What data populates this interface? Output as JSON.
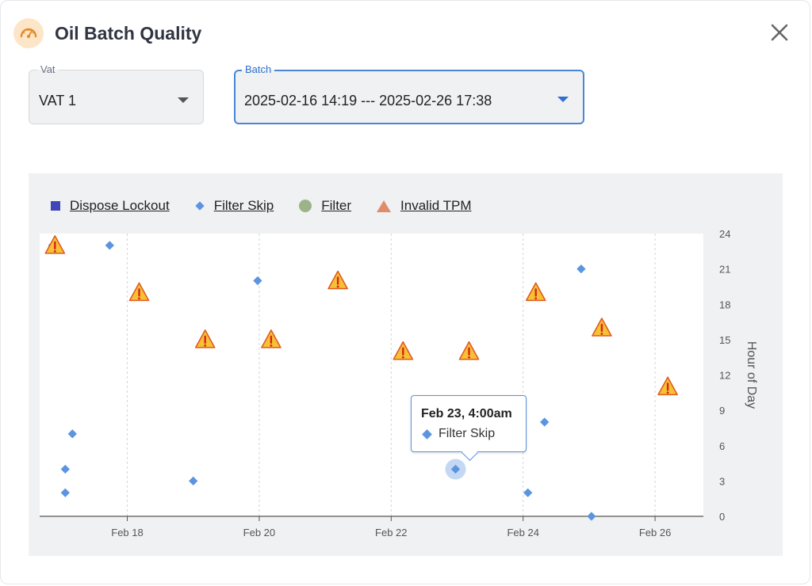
{
  "header": {
    "title": "Oil Batch Quality",
    "icon": "gauge-icon",
    "close_icon": "close-icon"
  },
  "filters": {
    "vat": {
      "label": "Vat",
      "value": "VAT 1"
    },
    "batch": {
      "label": "Batch",
      "value": "2025-02-16 14:19 --- 2025-02-26 17:38"
    }
  },
  "legend": [
    {
      "label": "Dispose Lockout",
      "marker": "square",
      "color": "#3f48b8"
    },
    {
      "label": "Filter Skip",
      "marker": "diamond",
      "color": "#5b94e0"
    },
    {
      "label": "Filter",
      "marker": "circle",
      "color": "#9cb38a"
    },
    {
      "label": "Invalid TPM",
      "marker": "triangle",
      "color": "#e08c6a"
    }
  ],
  "tooltip": {
    "title": "Feb 23, 4:00am",
    "series": "Filter Skip"
  },
  "chart_data": {
    "type": "scatter",
    "x_unit": "date",
    "ylabel": "Hour of Day",
    "ylim": [
      0,
      24
    ],
    "y_ticks": [
      0,
      3,
      6,
      9,
      12,
      15,
      18,
      21,
      24
    ],
    "x_ticks": [
      "Feb 18",
      "Feb 20",
      "Feb 22",
      "Feb 24",
      "Feb 26"
    ],
    "grid": "vertical dashed",
    "legend_position": "top-left",
    "series": [
      {
        "name": "Filter Skip",
        "points": [
          {
            "x": "2025-02-17",
            "y": 23
          },
          {
            "x": "2025-02-17",
            "y": 2
          },
          {
            "x": "2025-02-17",
            "y": 4
          },
          {
            "x": "2025-02-17",
            "y": 7
          },
          {
            "x": "2025-02-17",
            "y": 23
          },
          {
            "x": "2025-02-19",
            "y": 3
          },
          {
            "x": "2025-02-20",
            "y": 20
          },
          {
            "x": "2025-02-23",
            "y": 4
          },
          {
            "x": "2025-02-24",
            "y": 2
          },
          {
            "x": "2025-02-24",
            "y": 8
          },
          {
            "x": "2025-02-25",
            "y": 0
          },
          {
            "x": "2025-02-25",
            "y": 21
          }
        ]
      },
      {
        "name": "Invalid TPM",
        "points": [
          {
            "x": "2025-02-17",
            "y": 23
          },
          {
            "x": "2025-02-18",
            "y": 19
          },
          {
            "x": "2025-02-19",
            "y": 15
          },
          {
            "x": "2025-02-20",
            "y": 15
          },
          {
            "x": "2025-02-21",
            "y": 20
          },
          {
            "x": "2025-02-22",
            "y": 14
          },
          {
            "x": "2025-02-23",
            "y": 14
          },
          {
            "x": "2025-02-24",
            "y": 19
          },
          {
            "x": "2025-02-25",
            "y": 16
          },
          {
            "x": "2025-02-26",
            "y": 11
          }
        ]
      }
    ]
  }
}
